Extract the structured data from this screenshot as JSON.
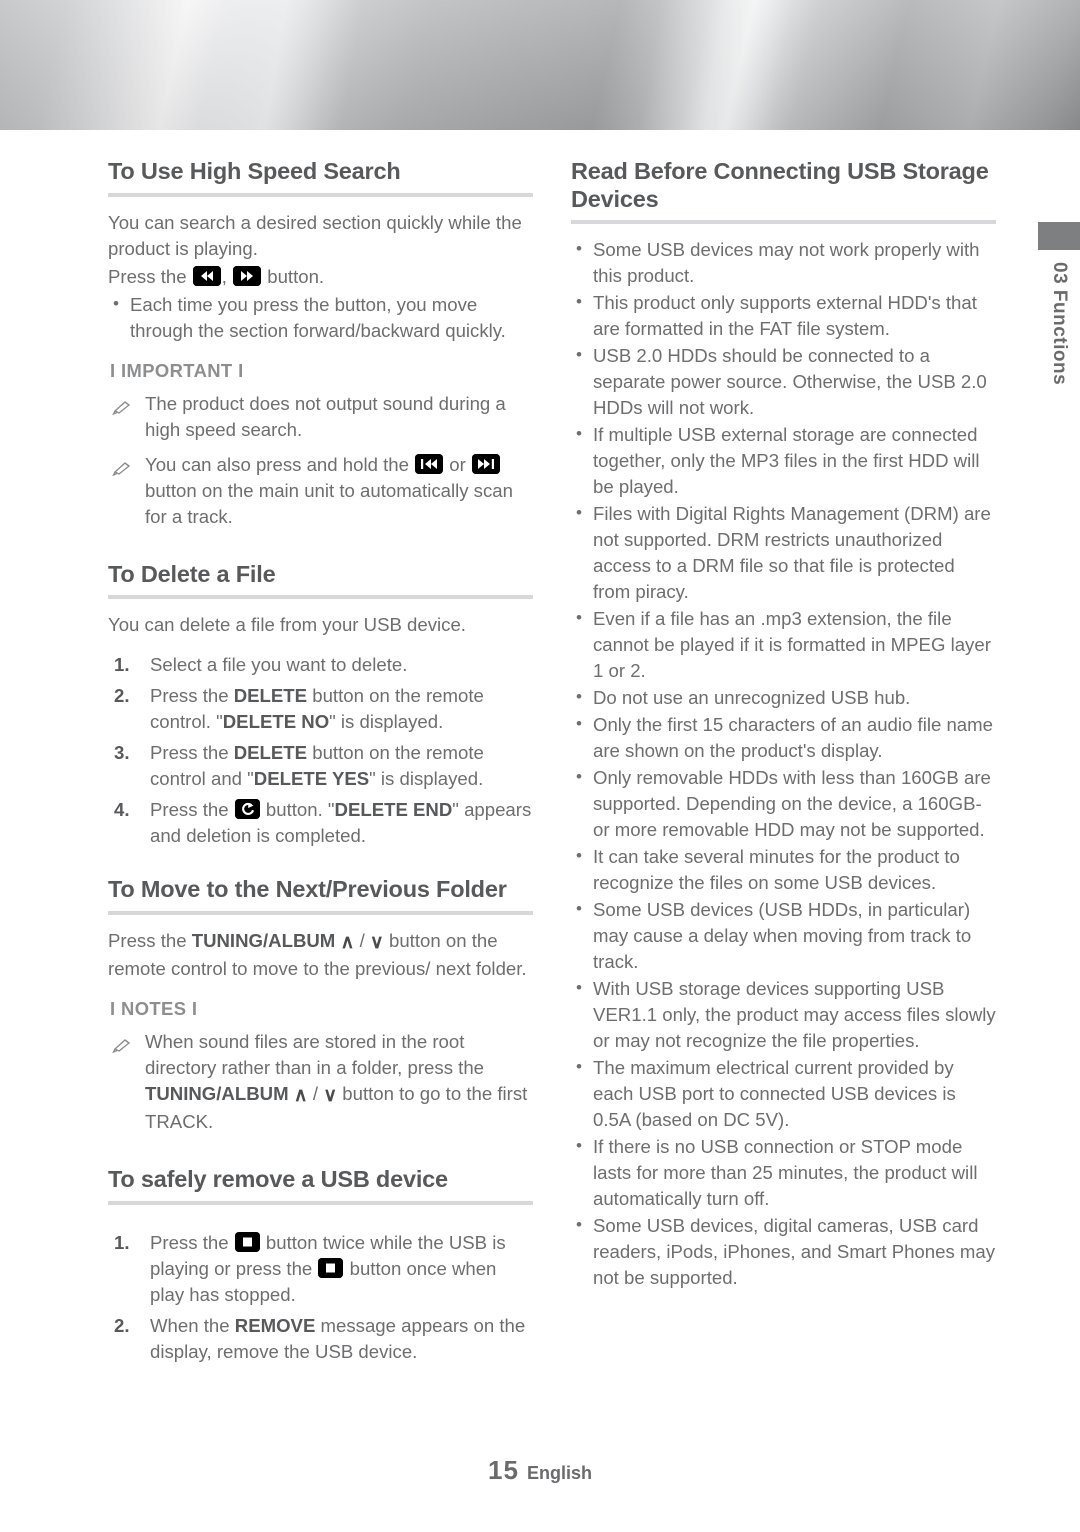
{
  "side_tab": {
    "chapter_number": "03",
    "chapter_label": "Functions",
    "combined": "03  Functions"
  },
  "footer": {
    "page_number": "15",
    "language": "English"
  },
  "left_column": {
    "section1": {
      "title": "To Use High Speed Search",
      "intro": "You can search a desired section quickly while the product is playing.",
      "press_prefix": "Press the",
      "press_separator": ",",
      "press_suffix": "button.",
      "bullets": [
        "Each time you press the button, you move through the section forward/backward quickly."
      ],
      "important_label": "I IMPORTANT I",
      "notes": [
        {
          "parts": [
            "The product does not output sound during a high speed search."
          ]
        },
        {
          "prefix": "You can also press and hold the",
          "middle": "or",
          "suffix": "button on the main unit to automatically scan for a track."
        }
      ]
    },
    "section2": {
      "title": "To Delete a File",
      "intro": "You can delete a file from your USB device.",
      "steps": [
        {
          "text_before": "Select a file you want to delete."
        },
        {
          "a": "Press the ",
          "b": "DELETE",
          "c": " button on the remote control. \"",
          "d": "DELETE NO",
          "e": "\" is displayed."
        },
        {
          "a": "Press the ",
          "b": "DELETE",
          "c": " button on the remote control and \"",
          "d": "DELETE YES",
          "e": "\" is displayed."
        },
        {
          "a": "Press the ",
          "c": " button. \"",
          "d": "DELETE END",
          "e": "\" appears and deletion is completed."
        }
      ]
    },
    "section3": {
      "title": "To Move to the Next/Previous Folder",
      "press_a": "Press the ",
      "press_b": "TUNING/ALBUM",
      "chev_up": "∧",
      "chev_slash": "/",
      "chev_down": "∨",
      "press_c": " button on the remote control to move to the previous/ next folder.",
      "notes_label": "I NOTES I",
      "note": {
        "a": "When sound files are stored in the root directory rather than in a folder, press the ",
        "b": "TUNING/ALBUM",
        "c": " button to go to the first TRACK."
      }
    },
    "section4": {
      "title": "To safely remove a USB device",
      "steps": [
        {
          "a": "Press the ",
          "b": " button twice while the USB is playing or press the ",
          "c": " button once when play has stopped."
        },
        {
          "a": "When the ",
          "b": "REMOVE",
          "c": " message appears on the display, remove the USB device."
        }
      ]
    }
  },
  "right_column": {
    "title": "Read Before Connecting USB Storage Devices",
    "bullets": [
      "Some USB devices may not work properly with this product.",
      "This product only supports external HDD's that are formatted in the FAT file system.",
      "USB 2.0 HDDs should be connected to a separate power source. Otherwise, the USB 2.0 HDDs will not work.",
      "If multiple USB external storage are connected together, only the MP3 files in the first HDD will be played.",
      "Files with Digital Rights Management (DRM) are not supported. DRM restricts unauthorized access to a DRM file so that file is protected from piracy.",
      "Even if a file has an .mp3 extension, the file cannot be played if it is formatted in MPEG layer 1 or 2.",
      "Do not use an unrecognized USB hub.",
      "Only the first 15 characters of an audio file name are shown on the product's display.",
      "Only removable HDDs with less than 160GB are supported. Depending on the device, a 160GB- or more removable HDD may not be supported.",
      "It can take several minutes for the product to recognize the files on some USB devices.",
      "Some USB devices (USB HDDs, in particular) may cause a delay when moving from track to track.",
      "With USB storage devices supporting USB VER1.1 only, the product may access files slowly or may not recognize the file properties.",
      "The maximum electrical current provided by each USB port to connected USB devices is 0.5A (based on DC 5V).",
      "If there is no USB connection or STOP mode lasts for more than 25 minutes, the product will automatically turn off.",
      "Some USB devices, digital cameras, USB card readers, iPods, iPhones, and Smart Phones may not be supported."
    ]
  },
  "icons": {
    "rewind": "rewind-icon",
    "fast_forward": "fast-forward-icon",
    "skip_back": "skip-back-icon",
    "skip_forward": "skip-forward-icon",
    "enter": "enter-icon",
    "stop": "stop-icon",
    "pencil": "pencil-icon"
  },
  "colors": {
    "heading": "#58595b",
    "body": "#6e6e70",
    "rule": "#d7d8da",
    "tab_block": "#7e7f81"
  }
}
